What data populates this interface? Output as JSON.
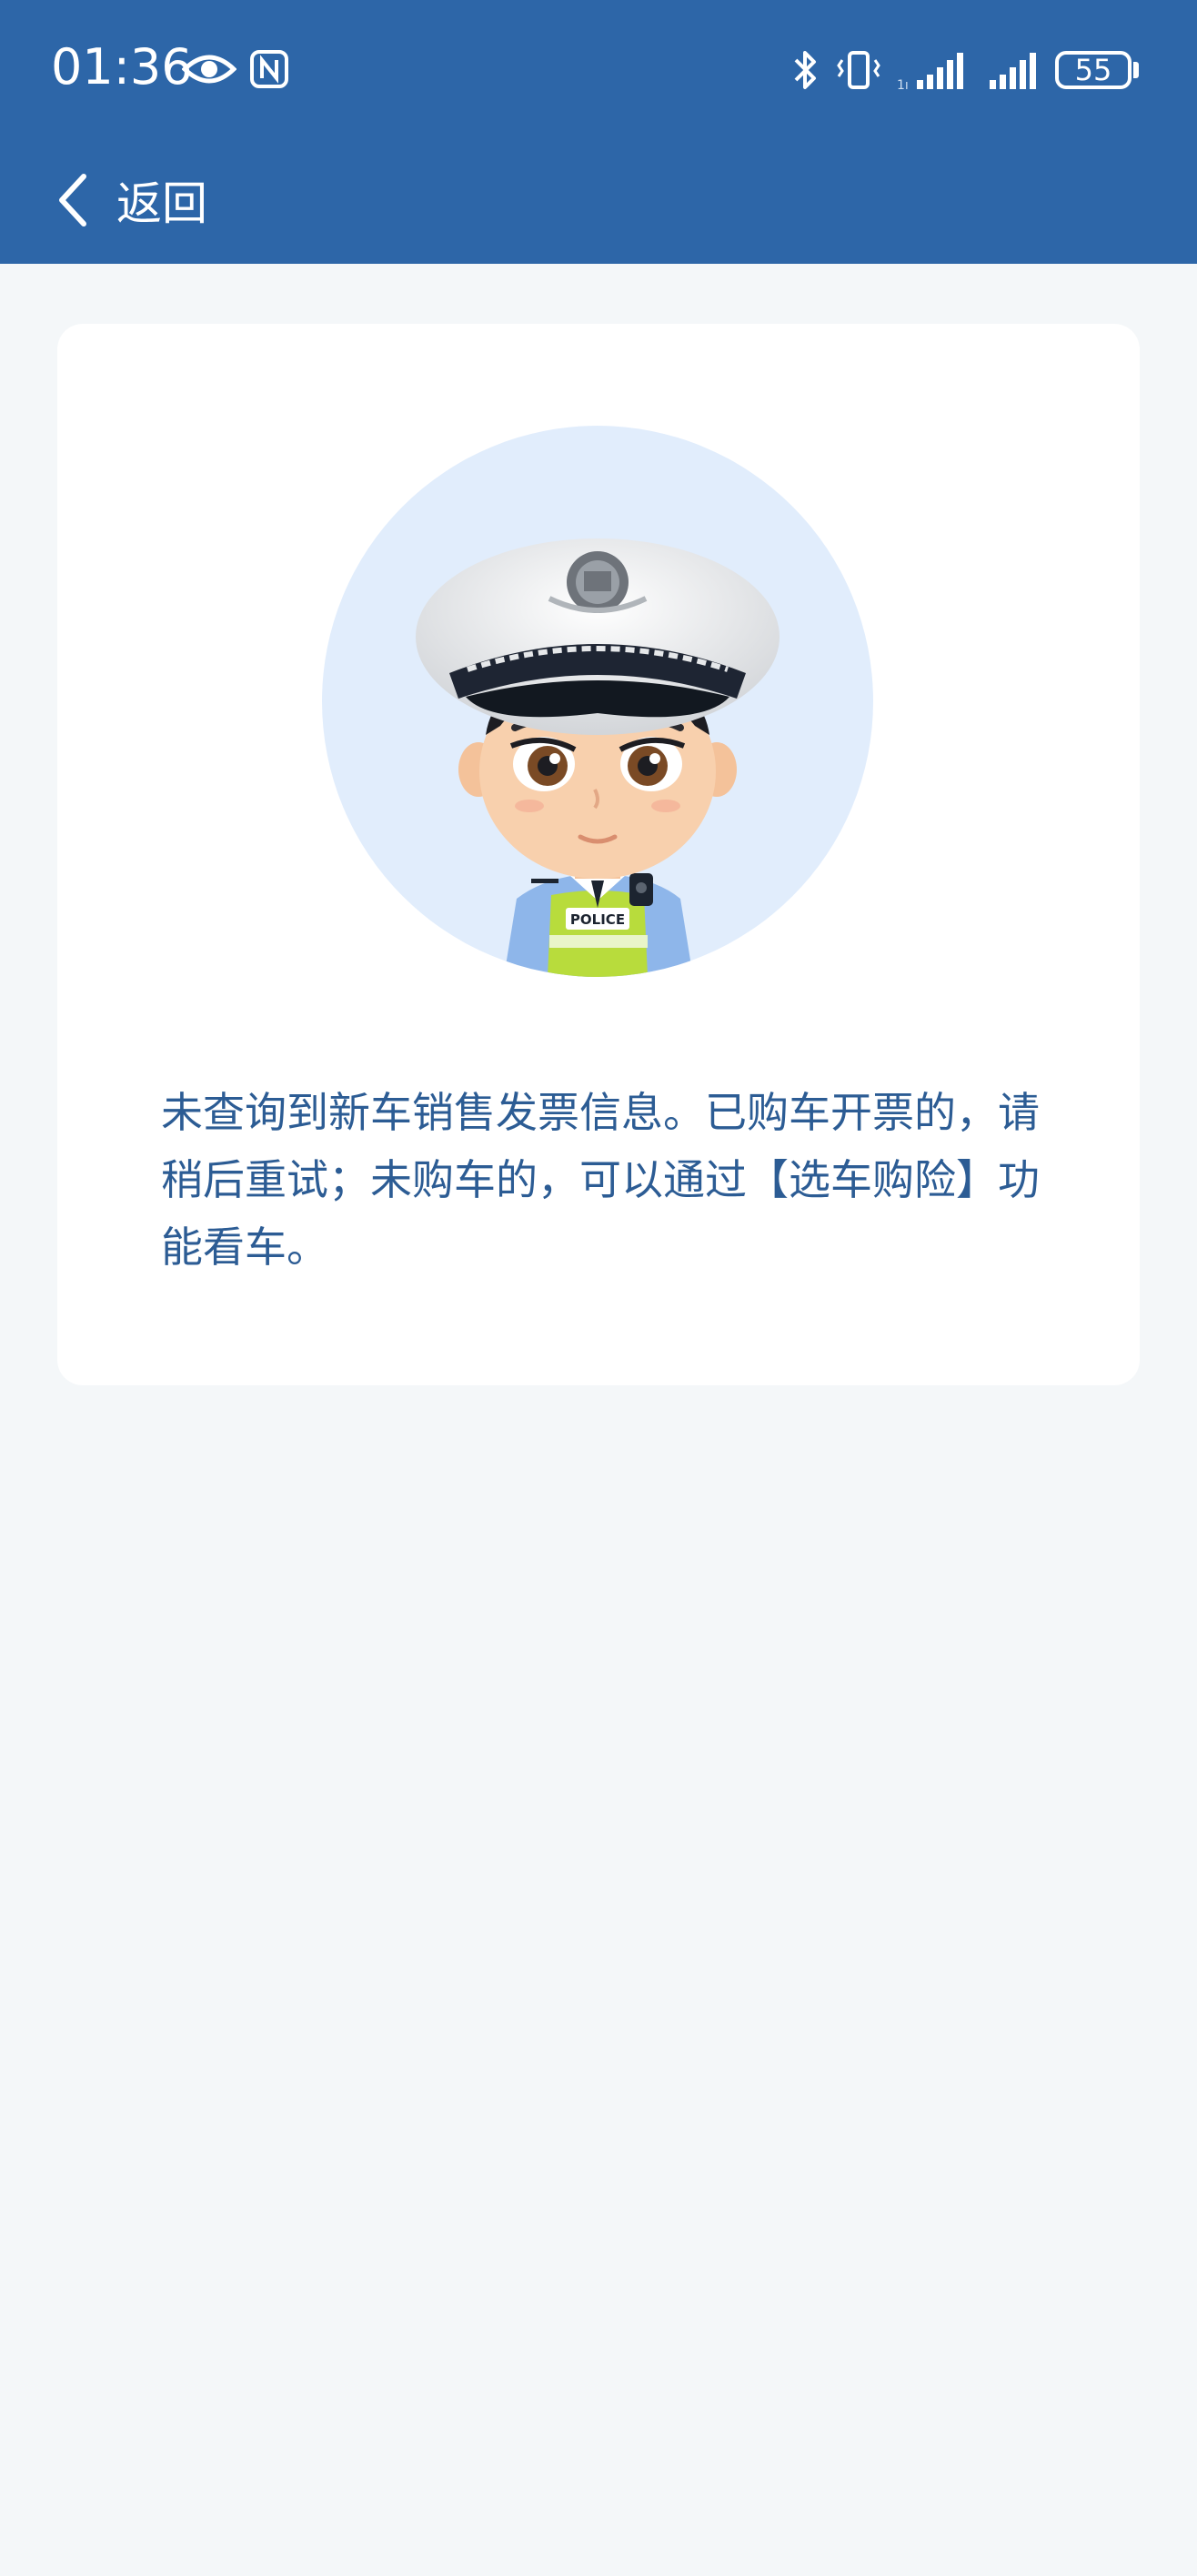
{
  "status_bar": {
    "time": "01:36",
    "battery": "55",
    "icons": [
      "eye-icon",
      "nfc-icon",
      "bluetooth-icon",
      "vibrate-icon",
      "signal-icon",
      "signal-icon"
    ]
  },
  "nav": {
    "back_label": "返回"
  },
  "card": {
    "illustration": "police-officer-avatar",
    "badge_text": "POLICE",
    "message": "未查询到新车销售发票信息。已购车开票的，请稍后重试；未购车的，可以通过【选车购险】功能看车。"
  },
  "colors": {
    "header_bg": "#2d66a8",
    "page_bg": "#f4f7f9",
    "message_text": "#2c5c94",
    "avatar_circle": "#e1edfc"
  }
}
